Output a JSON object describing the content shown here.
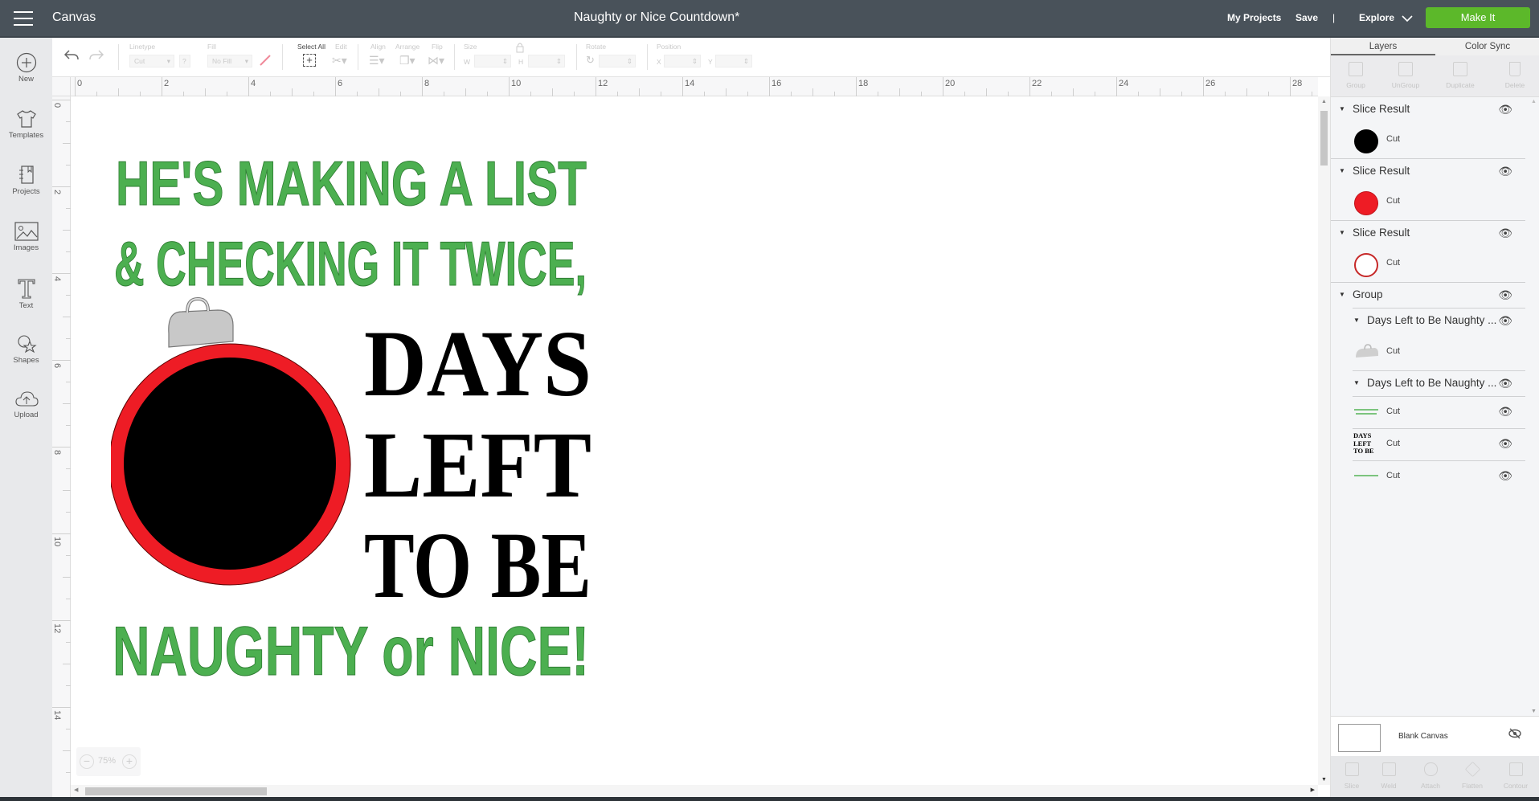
{
  "topbar": {
    "app_title": "Canvas",
    "doc_title": "Naughty or Nice Countdown*",
    "links": [
      "My Projects",
      "Save",
      "|",
      "Explore"
    ],
    "make_it": "Make It",
    "make_it_color": "#5cb82a"
  },
  "sidebar": {
    "items": [
      {
        "label": "New",
        "icon": "plus-circle-icon"
      },
      {
        "label": "Templates",
        "icon": "shirt-icon"
      },
      {
        "label": "Projects",
        "icon": "notebook-icon"
      },
      {
        "label": "Images",
        "icon": "image-icon"
      },
      {
        "label": "Text",
        "icon": "text-icon"
      },
      {
        "label": "Shapes",
        "icon": "shapes-icon"
      },
      {
        "label": "Upload",
        "icon": "cloud-upload-icon"
      }
    ]
  },
  "toolbar": {
    "linetype_label": "Linetype",
    "linetype_value": "Cut",
    "fill_label": "Fill",
    "fill_value": "No Fill",
    "select_all": "Select All",
    "edit": "Edit",
    "align": "Align",
    "arrange": "Arrange",
    "flip": "Flip",
    "size": "Size",
    "w": "W",
    "h": "H",
    "rotate": "Rotate",
    "position": "Position",
    "x": "X",
    "y": "Y"
  },
  "ruler": {
    "h_ticks": [
      "0",
      "2",
      "4",
      "6",
      "8",
      "10",
      "12",
      "14",
      "16",
      "18",
      "20",
      "22",
      "24",
      "26",
      "28"
    ],
    "v_ticks": [
      "0",
      "2",
      "4",
      "6",
      "8",
      "10",
      "12",
      "14"
    ]
  },
  "canvas": {
    "zoom": "75%",
    "design": {
      "line1": "HE'S MAKING A LIST",
      "line2": "& CHECKING IT TWICE,",
      "line3": "DAYS",
      "line4": "LEFT",
      "line5": "TO BE",
      "line6": "NAUGHTY or NICE!",
      "green": "#4caf50",
      "red": "#ee1c25",
      "black": "#000000",
      "cap_gray": "#c8c8c8"
    }
  },
  "panel": {
    "tabs": [
      "Layers",
      "Color Sync"
    ],
    "tools": [
      "Group",
      "UnGroup",
      "Duplicate",
      "Delete"
    ],
    "layers": [
      {
        "name": "Slice Result",
        "sub": "Cut",
        "swatch": "black"
      },
      {
        "name": "Slice Result",
        "sub": "Cut",
        "swatch": "red"
      },
      {
        "name": "Slice Result",
        "sub": "Cut",
        "swatch": "red-outline"
      }
    ],
    "group": {
      "name": "Group",
      "children": [
        {
          "name": "Days Left to Be Naughty ...",
          "subs": [
            {
              "label": "Cut",
              "thumb": "ornament-cap"
            }
          ]
        },
        {
          "name": "Days Left to Be Naughty ...",
          "subs": [
            {
              "label": "Cut",
              "thumb": "green-text-top"
            },
            {
              "label": "Cut",
              "thumb": "days-left-to-be"
            },
            {
              "label": "Cut",
              "thumb": "green-text-bottom"
            }
          ]
        }
      ]
    },
    "thumb_text": [
      "DAYS",
      "LEFT",
      "TO BE"
    ],
    "blank_canvas": "Blank Canvas",
    "bottom_tools": [
      "Slice",
      "Weld",
      "Attach",
      "Flatten",
      "Contour"
    ]
  }
}
